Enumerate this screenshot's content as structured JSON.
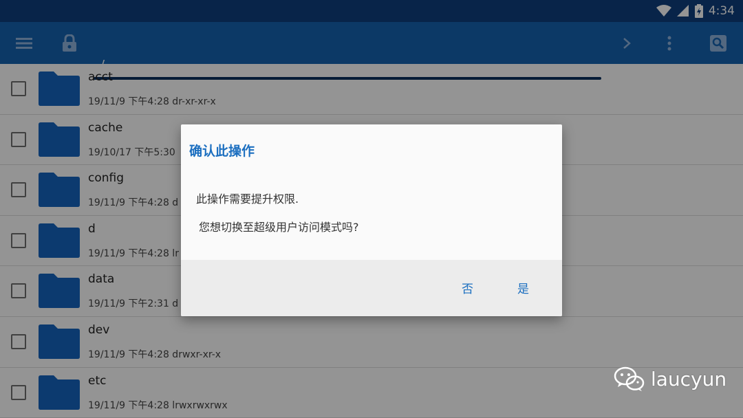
{
  "status_bar": {
    "time": "4:34",
    "icons": [
      "wifi-icon",
      "signal-icon",
      "battery-charging-icon"
    ],
    "color": "#0e3e7e"
  },
  "toolbar": {
    "color": "#1562b0",
    "path": "/",
    "icons": [
      "menu-icon",
      "lock-icon",
      "chevron-right-icon",
      "more-vert-icon",
      "search-icon"
    ]
  },
  "files": [
    {
      "name": "acct",
      "meta": "19/11/9 下午4:28  dr-xr-xr-x"
    },
    {
      "name": "cache",
      "meta": "19/10/17 下午5:30"
    },
    {
      "name": "config",
      "meta": "19/11/9 下午4:28  d"
    },
    {
      "name": "d",
      "meta": "19/11/9 下午4:28  lr"
    },
    {
      "name": "data",
      "meta": "19/11/9 下午2:31  d"
    },
    {
      "name": "dev",
      "meta": "19/11/9 下午4:28  drwxr-xr-x"
    },
    {
      "name": "etc",
      "meta": "19/11/9 下午4:28  lrwxrwxrwx"
    }
  ],
  "dialog": {
    "title": "确认此操作",
    "message1": "此操作需要提升权限.",
    "message2": "您想切换至超级用户访问模式吗?",
    "no_label": "否",
    "yes_label": "是",
    "accent": "#1c6fc0"
  },
  "watermark": {
    "text": "laucyun"
  }
}
